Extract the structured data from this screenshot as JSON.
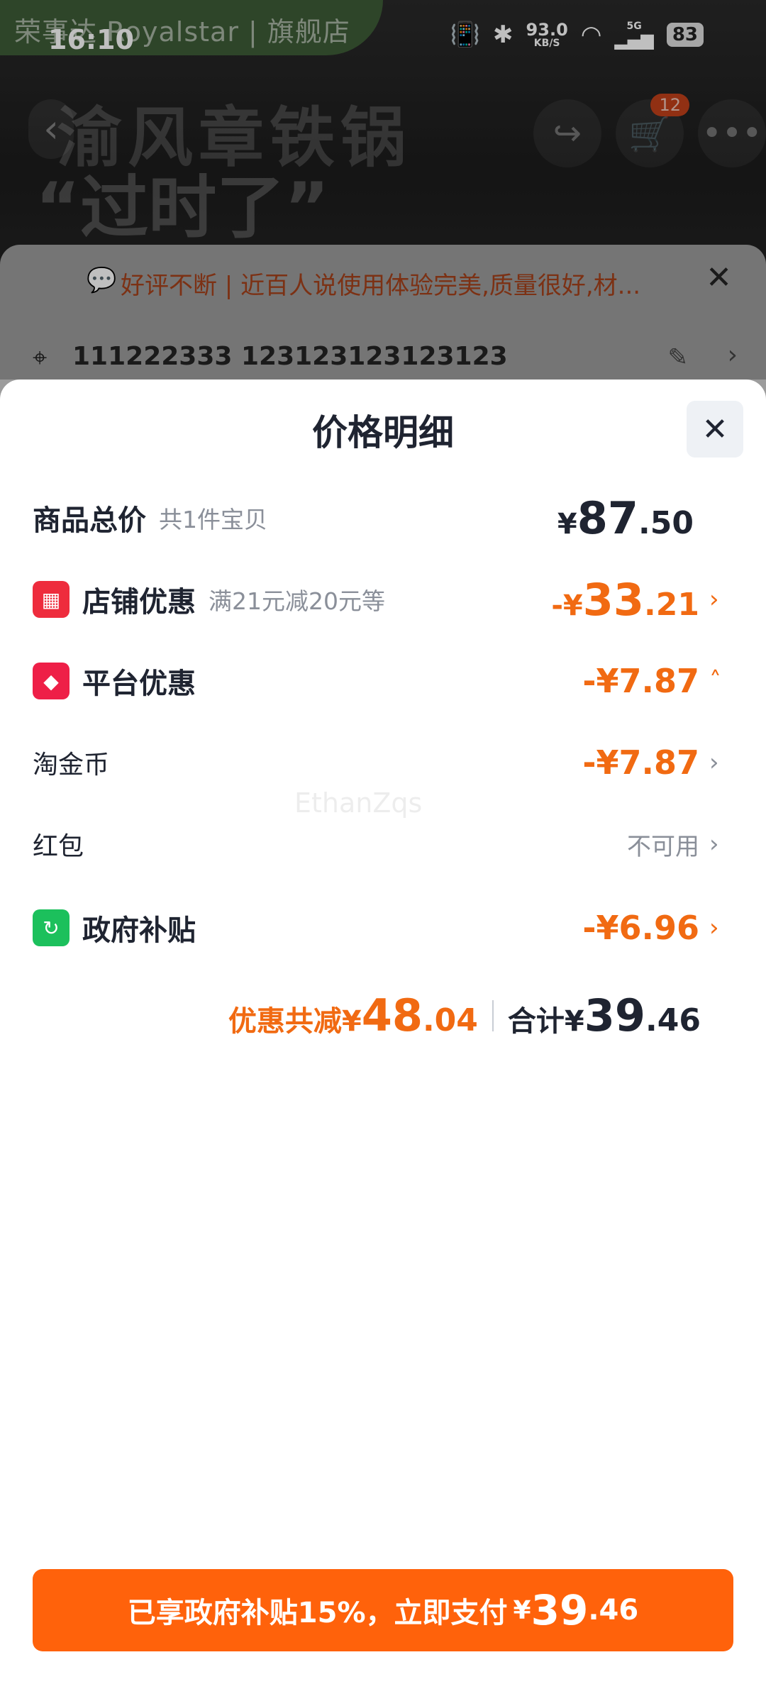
{
  "status_bar": {
    "time": "16:10",
    "net_speed": "93.0",
    "net_unit": "KB/S",
    "signal_label": "5G",
    "battery": "83"
  },
  "background_page": {
    "shop_name": "荣事达 Royalstar | 旗舰店",
    "poster_title": "渝风章铁锅",
    "poster_subtitle": "“过时了”",
    "cart_badge": "12",
    "review_text": "好评不断 | 近百人说使用体验完美,质量很好,材...",
    "address": "111222333 123123123123123"
  },
  "sheet": {
    "title": "价格明细",
    "rows": {
      "total": {
        "label": "商品总价",
        "sub": "共1件宝贝",
        "currency": "¥",
        "int": "87",
        "dec": ".50"
      },
      "store_discount": {
        "label": "店铺优惠",
        "sub": "满21元减20元等",
        "prefix": "-¥",
        "int": "33",
        "dec": ".21"
      },
      "platform_discount": {
        "label": "平台优惠",
        "amount": "-¥7.87"
      },
      "taojinbi": {
        "label": "淘金币",
        "amount": "-¥7.87"
      },
      "red_packet": {
        "label": "红包",
        "status": "不可用"
      },
      "gov_subsidy": {
        "label": "政府补贴",
        "amount": "-¥6.96"
      }
    },
    "summary": {
      "discount_label": "优惠共减¥",
      "discount_int": "48",
      "discount_dec": ".04",
      "total_label": "合计¥",
      "total_int": "39",
      "total_dec": ".46"
    },
    "watermark": "EthanZqs",
    "pay_button": {
      "text": "已享政府补贴15%，立即支付",
      "currency": "¥",
      "int": "39",
      "dec": ".46"
    }
  },
  "colors": {
    "accent": "#ff620b",
    "discount": "#f16a12",
    "text_primary": "#1f2431",
    "text_secondary": "#8a8f99"
  }
}
